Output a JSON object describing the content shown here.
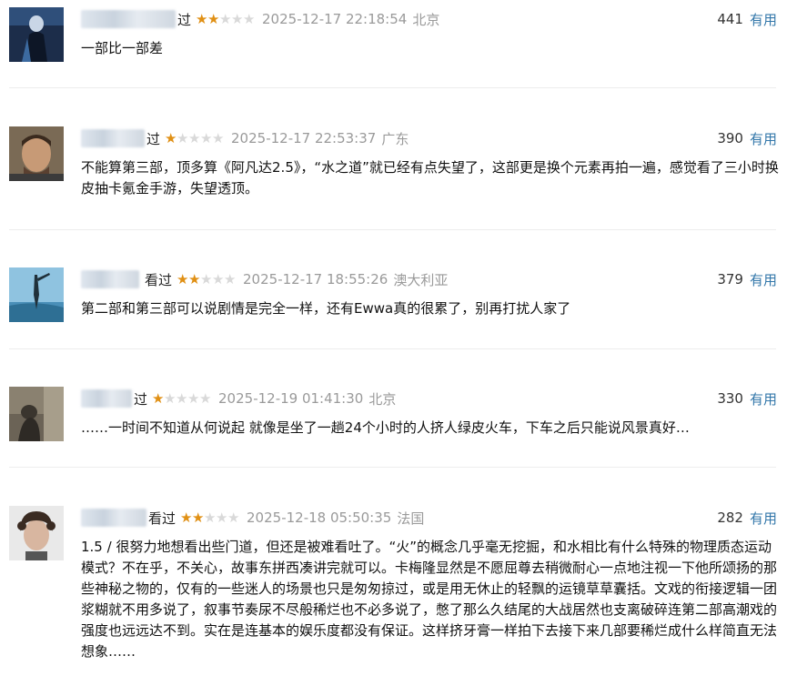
{
  "reviews": [
    {
      "username": "",
      "watched_label": "过",
      "rating": 2,
      "time": "2025-12-17 22:18:54",
      "location": "北京",
      "votes": "441",
      "useful_label": "有用",
      "content": "一部比一部差"
    },
    {
      "username": "",
      "watched_label": "过",
      "rating": 1,
      "time": "2025-12-17 22:53:37",
      "location": "广东",
      "votes": "390",
      "useful_label": "有用",
      "content": "不能算第三部，顶多算《阿凡达2.5》，“水之道”就已经有点失望了，这部更是换个元素再拍一遍，感觉看了三小时换皮抽卡氪金手游，失望透顶。"
    },
    {
      "username": "",
      "watched_label": "看过",
      "rating": 2,
      "time": "2025-12-17 18:55:26",
      "location": "澳大利亚",
      "votes": "379",
      "useful_label": "有用",
      "content": "第二部和第三部可以说剧情是完全一样，还有Ewwa真的很累了，别再打扰人家了"
    },
    {
      "username": "",
      "watched_label": "过",
      "rating": 1,
      "time": "2025-12-19 01:41:30",
      "location": "北京",
      "votes": "330",
      "useful_label": "有用",
      "content": "……一时间不知道从何说起 就像是坐了一趟24个小时的人挤人绿皮火车，下车之后只能说风景真好…"
    },
    {
      "username": "",
      "watched_label": "看过",
      "rating": 2,
      "time": "2025-12-18 05:50:35",
      "location": "法国",
      "votes": "282",
      "useful_label": "有用",
      "content": "1.5 / 很努力地想看出些门道，但还是被难看吐了。“火”的概念几乎毫无挖掘，和水相比有什么特殊的物理质态运动模式？不在乎，不关心，故事东拼西凑讲完就可以。卡梅隆显然是不愿屈尊去稍微耐心一点地注视一下他所颂扬的那些神秘之物的，仅有的一些迷人的场景也只是匆匆掠过，或是用无休止的轻飘的运镜草草囊括。文戏的衔接逻辑一团浆糊就不用多说了，叙事节奏尿不尽般稀烂也不必多说了，憋了那么久结尾的大战居然也支离破碎连第二部高潮戏的强度也远远达不到。实在是连基本的娱乐度都没有保证。这样挤牙膏一样拍下去接下来几部要稀烂成什么样简直无法想象……"
    }
  ],
  "colors": {
    "star_on": "#e09015",
    "star_off": "#d9d9d9",
    "link": "#3377aa",
    "meta_gray": "#9a9a9a",
    "divider": "#ededed"
  }
}
